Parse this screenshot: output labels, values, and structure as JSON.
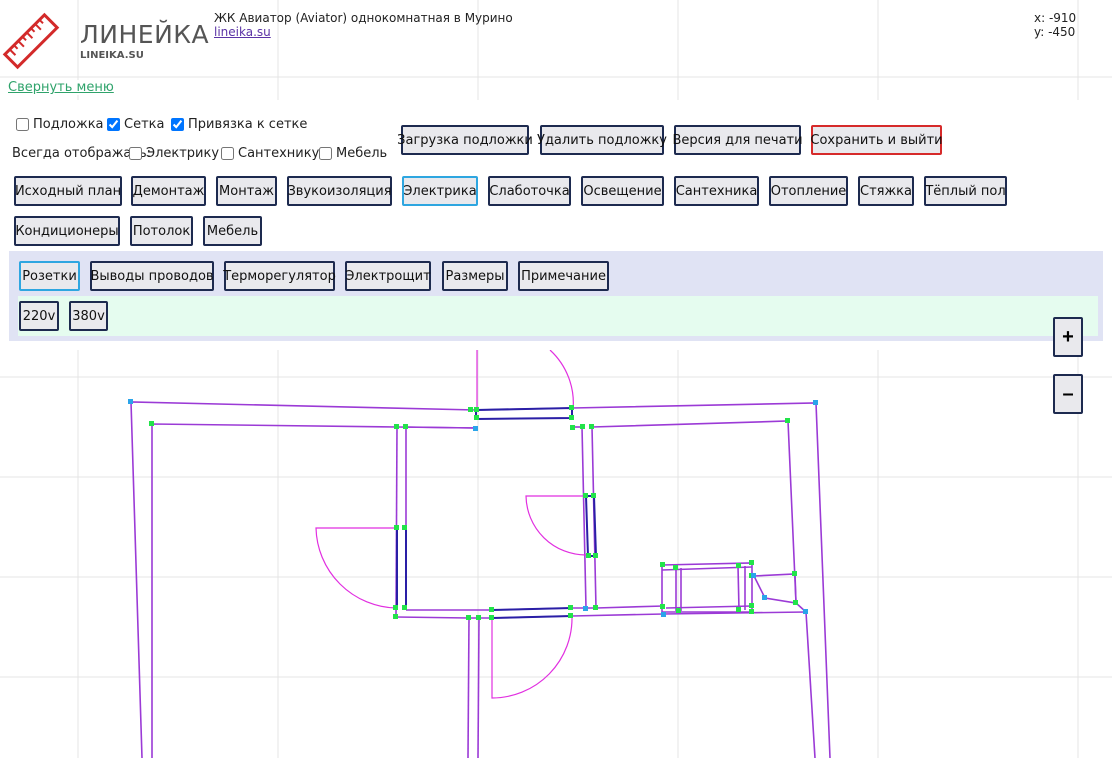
{
  "header": {
    "logo_title": "ЛИНЕЙКА",
    "logo_subtitle": "LINEIKA.SU",
    "project_title": "ЖК Авиатор (Aviator) однокомнатная в Мурино",
    "project_link": "lineika.su",
    "coord_x": "x: -910",
    "coord_y": "y: -450"
  },
  "collapse_menu": "Свернуть меню",
  "options": {
    "underlay": {
      "label": "Подложка",
      "checked": false
    },
    "grid": {
      "label": "Сетка",
      "checked": true
    },
    "snap": {
      "label": "Привязка к сетке",
      "checked": true
    },
    "always_show_label": "Всегда отображать:",
    "show_electric": {
      "label": "Электрику",
      "checked": false
    },
    "show_plumbing": {
      "label": "Сантехнику",
      "checked": false
    },
    "show_furniture": {
      "label": "Мебель",
      "checked": false
    }
  },
  "actions": {
    "load_underlay": "Загрузка подложки",
    "delete_underlay": "Удалить подложку",
    "print_version": "Версия для печати",
    "save_exit": "Сохранить и выйти"
  },
  "stages": [
    "Исходный план",
    "Демонтаж",
    "Монтаж",
    "Звукоизоляция",
    "Электрика",
    "Слаботочка",
    "Освещение",
    "Сантехника",
    "Отопление",
    "Стяжка",
    "Тёплый пол",
    "Кондиционеры",
    "Потолок",
    "Мебель"
  ],
  "active_stage": "Электрика",
  "electric_tools": [
    "Розетки",
    "Выводы проводов",
    "Терморегулятор",
    "Электрощит",
    "Размеры",
    "Примечание"
  ],
  "active_tool": "Розетки",
  "voltage_options": [
    "220v",
    "380v"
  ],
  "zoom": {
    "in": "+",
    "out": "–"
  },
  "colors": {
    "wall": "#9b3ad6",
    "wall_dark": "#2a1fa6",
    "door_arc": "#e12fe0",
    "node_green": "#22e34a",
    "node_blue": "#2aa4ea",
    "active_border": "#2ea6e0",
    "danger_border": "#d62a2a",
    "link_green": "#2fa36b"
  },
  "icons": {
    "logo": "ruler-icon"
  }
}
